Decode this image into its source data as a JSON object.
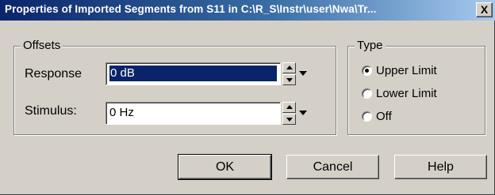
{
  "window": {
    "title": "Properties of Imported Segments from S11 in C:\\R_S\\Instr\\user\\Nwa\\Tr...",
    "close_glyph": "X"
  },
  "offsets": {
    "legend": "Offsets",
    "response_label": "Response",
    "response_value": "0 dB",
    "stimulus_label": "Stimulus:",
    "stimulus_value": "0 Hz"
  },
  "type": {
    "legend": "Type",
    "options": [
      {
        "label": "Upper Limit",
        "selected": true
      },
      {
        "label": "Lower Limit",
        "selected": false
      },
      {
        "label": "Off",
        "selected": false
      }
    ]
  },
  "buttons": {
    "ok": "OK",
    "cancel": "Cancel",
    "help": "Help"
  }
}
